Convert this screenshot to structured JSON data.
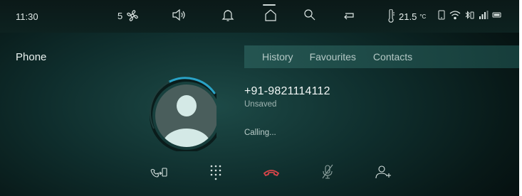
{
  "status_bar": {
    "time": "11:30",
    "fan_speed": "5",
    "temperature": "21.5",
    "temperature_unit": "°C",
    "icons": [
      "fan-icon",
      "volume-icon",
      "bell-icon",
      "home-icon",
      "search-icon",
      "return-icon",
      "thermometer-icon",
      "phone-small-icon",
      "wifi-icon",
      "bluetooth-battery-icon",
      "signal-icon",
      "battery-icon"
    ]
  },
  "page": {
    "title": "Phone"
  },
  "tabs": [
    {
      "label": "History"
    },
    {
      "label": "Favourites"
    },
    {
      "label": "Contacts"
    }
  ],
  "call": {
    "number": "+91-9821114112",
    "contact_status": "Unsaved",
    "call_state": "Calling..."
  },
  "controls": [
    "transfer-to-phone-icon",
    "keypad-icon",
    "end-call-icon",
    "mute-mic-icon",
    "add-contact-icon"
  ],
  "colors": {
    "accent_ring": "#2aa3c7",
    "end_call": "#d8454a",
    "avatar_bg": "#cfe6e3"
  }
}
